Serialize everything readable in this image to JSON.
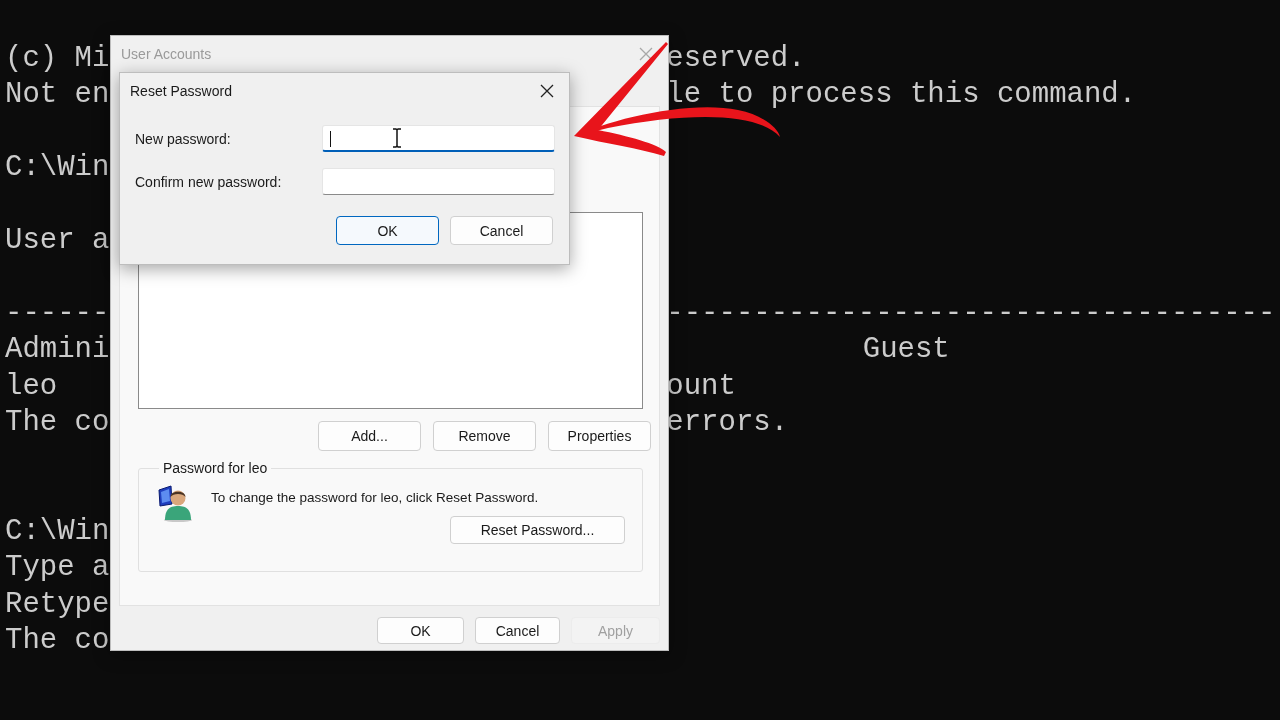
{
  "terminal": {
    "lines": [
      {
        "kind": "text",
        "start": "(c) Mi",
        "middle": "eserved."
      },
      {
        "kind": "text",
        "start": "Not en",
        "middle": "le to process this command."
      },
      {
        "kind": "blank"
      },
      {
        "kind": "text",
        "start": "C:\\Win"
      },
      {
        "kind": "blank"
      },
      {
        "kind": "text",
        "start": "User a"
      },
      {
        "kind": "blank"
      },
      {
        "kind": "text",
        "start": "------",
        "middle": "-----------------------------------"
      },
      {
        "kind": "text",
        "start": "Admini",
        "end": "Guest"
      },
      {
        "kind": "text",
        "start": "leo",
        "middle": "ount"
      },
      {
        "kind": "text",
        "start": "The co",
        "middle": "errors."
      },
      {
        "kind": "blank"
      },
      {
        "kind": "blank"
      },
      {
        "kind": "text",
        "start": "C:\\Win"
      },
      {
        "kind": "text",
        "start": "Type a"
      },
      {
        "kind": "text",
        "start": "Retype"
      },
      {
        "kind": "text",
        "start": "The co"
      }
    ]
  },
  "user_accounts": {
    "title": "User Accounts",
    "active": false,
    "list_buttons": [
      {
        "label": "Add..."
      },
      {
        "label": "Remove"
      },
      {
        "label": "Properties"
      }
    ],
    "password_group": {
      "title": "Password for leo",
      "text": "To change the password for leo, click Reset Password.",
      "button": "Reset Password..."
    },
    "buttons": [
      {
        "label": "OK",
        "disabled": false
      },
      {
        "label": "Cancel",
        "disabled": false
      },
      {
        "label": "Apply",
        "disabled": true
      }
    ]
  },
  "reset_password": {
    "title": "Reset Password",
    "active": true,
    "fields": [
      {
        "label": "New password:",
        "focused": true
      },
      {
        "label": "Confirm new password:",
        "focused": false
      }
    ],
    "buttons": [
      {
        "label": "OK",
        "default": true
      },
      {
        "label": "Cancel",
        "default": false
      }
    ]
  }
}
